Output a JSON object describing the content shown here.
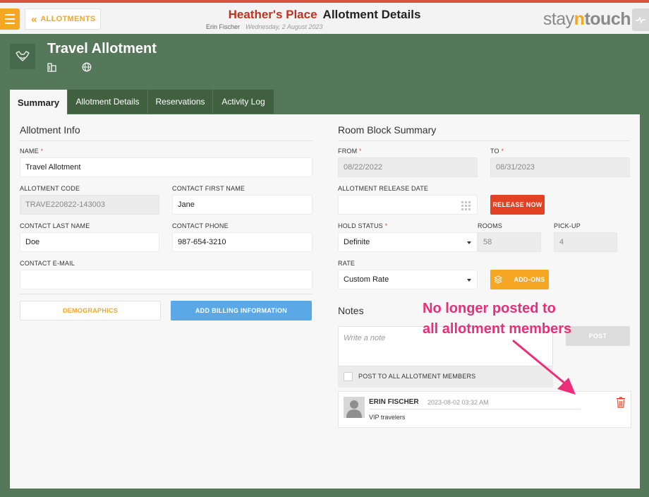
{
  "topbar": {
    "back_label": "ALLOTMENTS",
    "hotel_name": "Heather's Place",
    "page_title": "Allotment Details",
    "user_name": "Erin Fischer",
    "business_date": "Wednesday, 2 August 2023",
    "logo": {
      "part1": "stay",
      "part2": "n",
      "part3": "touch"
    },
    "menu_icon": "hamburger-icon",
    "colors": {
      "brand_red": "#d9553f",
      "orange": "#f5a623"
    }
  },
  "header": {
    "title": "Travel Allotment",
    "icons": [
      "building-icon",
      "globe-icon"
    ]
  },
  "tabs": [
    {
      "label": "Summary",
      "active": true
    },
    {
      "label": "Allotment Details",
      "active": false
    },
    {
      "label": "Reservations",
      "active": false
    },
    {
      "label": "Activity Log",
      "active": false
    }
  ],
  "allotment_info": {
    "title": "Allotment Info",
    "name": {
      "label": "NAME",
      "required": "*",
      "value": "Travel Allotment"
    },
    "code": {
      "label": "ALLOTMENT CODE",
      "value": "TRAVE220822-143003"
    },
    "first_name": {
      "label": "CONTACT FIRST NAME",
      "value": "Jane"
    },
    "last_name": {
      "label": "CONTACT LAST NAME",
      "value": "Doe"
    },
    "phone": {
      "label": "CONTACT PHONE",
      "value": "987-654-3210"
    },
    "email": {
      "label": "CONTACT E-MAIL",
      "value": ""
    },
    "demographics_label": "DEMOGRAPHICS",
    "billing_label": "ADD BILLING INFORMATION"
  },
  "room_block": {
    "title": "Room Block Summary",
    "from": {
      "label": "FROM",
      "required": "*",
      "value": "08/22/2022"
    },
    "to": {
      "label": "TO",
      "required": "*",
      "value": "08/31/2023"
    },
    "release_date": {
      "label": "ALLOTMENT RELEASE DATE",
      "value": ""
    },
    "release_now_label": "RELEASE NOW",
    "hold_status": {
      "label": "HOLD STATUS",
      "required": "*",
      "value": "Definite"
    },
    "rooms": {
      "label": "ROOMS",
      "value": "58"
    },
    "pickup": {
      "label": "PICK-UP",
      "value": "4"
    },
    "rate": {
      "label": "RATE",
      "value": "Custom Rate"
    },
    "addons_label": "ADD-ONS"
  },
  "notes": {
    "title": "Notes",
    "placeholder": "Write a note",
    "post_label": "POST",
    "post_all_label": "POST TO ALL ALLOTMENT MEMBERS",
    "items": [
      {
        "author": "ERIN FISCHER",
        "timestamp": "2023-08-02 03:32 AM",
        "text": "VIP travelers"
      }
    ]
  },
  "annotation": {
    "line1": "No longer posted to",
    "line2": "all allotment members",
    "color": "#ec2d7a"
  }
}
